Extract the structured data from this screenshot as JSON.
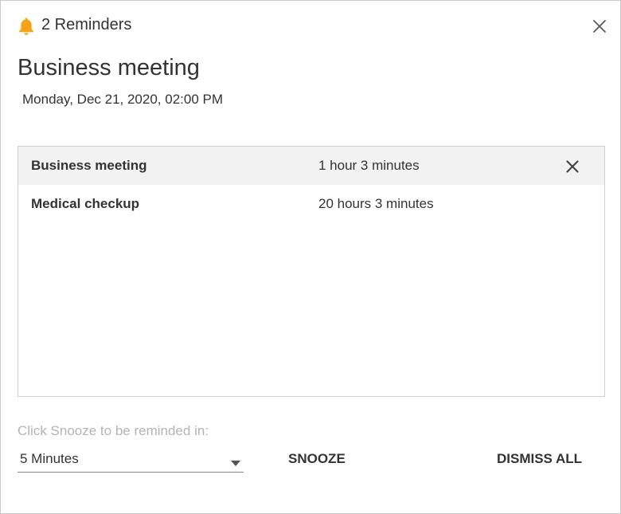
{
  "window": {
    "title": "2 Reminders",
    "icon": "bell-icon",
    "accent_color": "#f7a21b"
  },
  "event": {
    "title": "Business meeting",
    "datetime": "Monday, Dec 21, 2020, 02:00 PM"
  },
  "reminders": [
    {
      "name": "Business meeting",
      "due_in": "1 hour 3 minutes",
      "selected": true
    },
    {
      "name": "Medical checkup",
      "due_in": "20 hours 3 minutes",
      "selected": false
    }
  ],
  "snooze": {
    "label": "Click Snooze to be reminded in:",
    "selected_option": "5 Minutes",
    "snooze_button": "SNOOZE",
    "dismiss_all_button": "DISMISS ALL"
  }
}
